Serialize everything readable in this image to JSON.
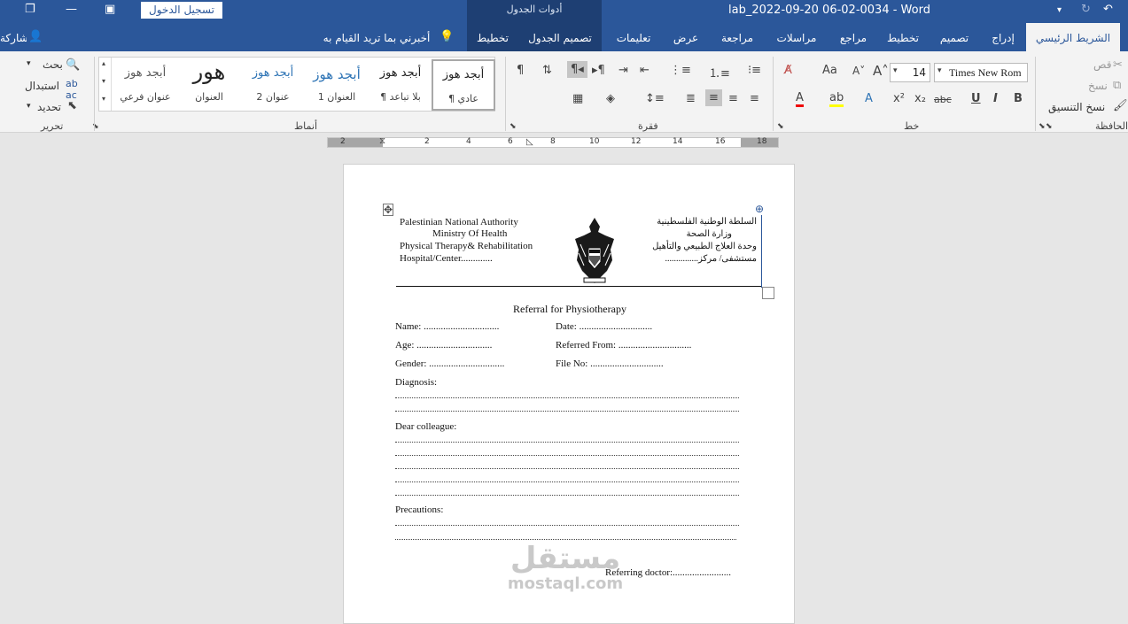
{
  "window": {
    "title": "lab_2022-09-20 06-02-0034  -  Word",
    "context_group": "أدوات الجدول",
    "login_label": "تسجيل الدخول"
  },
  "tabs": {
    "home": "الشريط الرئيسي",
    "insert": "إدراج",
    "design": "تصميم",
    "layout": "تخطيط",
    "references": "مراجع",
    "mailings": "مراسلات",
    "review": "مراجعة",
    "view": "عرض",
    "help": "تعليمات",
    "table_design": "تصميم الجدول",
    "table_layout": "تخطيط",
    "tell_me": "أخبرني بما تريد القيام به",
    "share": "مشاركة"
  },
  "ribbon": {
    "groups": {
      "clipboard": "الحافظة",
      "font": "خط",
      "paragraph": "فقرة",
      "styles": "أنماط",
      "editing": "تحرير"
    },
    "clipboard": {
      "cut": "قص",
      "copy": "نسخ",
      "format_painter": "نسخ التنسيق"
    },
    "font": {
      "name": "Times New Rom",
      "size": "14"
    },
    "editing": {
      "find": "بحث",
      "replace": "استبدال",
      "select": "تحديد"
    },
    "styles": [
      {
        "sample": "أبجد هوز",
        "name": "¶ عادي"
      },
      {
        "sample": "أبجد هوز",
        "name": "¶ بلا تباعد"
      },
      {
        "sample": "أبجد هوز",
        "name": "العنوان 1"
      },
      {
        "sample": "أبجد هوز",
        "name": "عنوان 2"
      },
      {
        "sample": "هور",
        "name": "العنوان"
      },
      {
        "sample": "أبجد هوز",
        "name": "عنوان فرعي"
      }
    ]
  },
  "ruler": {
    "marks": [
      "2",
      "2",
      "4",
      "6",
      "8",
      "10",
      "12",
      "14",
      "16",
      "18"
    ]
  },
  "document": {
    "header_en": [
      "Palestinian National Authority",
      "Ministry Of Health",
      "Physical Therapy& Rehabilitation",
      "Hospital/Center............."
    ],
    "header_ar": [
      "السلطة الوطنية الفلسطينية",
      "وزارة الصحة",
      "وحدة العلاج الطبيعي والتأهيل",
      "مستشفى/ مركز..............."
    ],
    "title": "Referral for Physiotherapy",
    "fields": {
      "name": "Name: ...............................",
      "date": "Date: ..............................",
      "age": "Age: ...............................",
      "referred_from": "Referred From: ..............................",
      "gender": "Gender: ...............................",
      "file_no": "File No: ..............................",
      "diagnosis": "Diagnosis:",
      "dear": "Dear colleague:",
      "precautions": "Precautions:",
      "referring_doctor": "Referring doctor:........................"
    }
  },
  "watermark": {
    "arabic": "مستقل",
    "latin": "mostaql.com"
  }
}
